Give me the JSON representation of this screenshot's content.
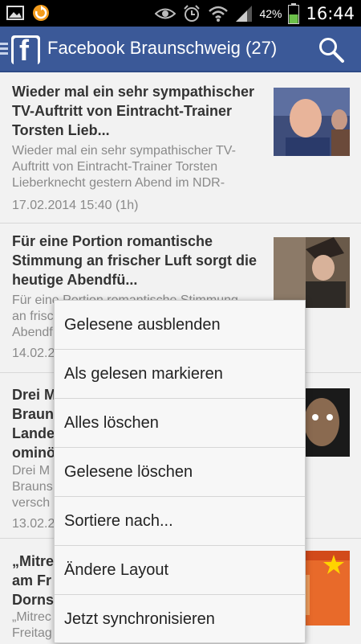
{
  "status_bar": {
    "battery_percent": "42%",
    "time": "16:44",
    "icons": [
      "image-icon",
      "notification-app-icon",
      "eye-icon",
      "alarm-icon",
      "wifi-icon",
      "signal-icon",
      "battery-icon"
    ]
  },
  "app_bar": {
    "title": "Facebook Braunschweig (27)",
    "brand_color": "#3b5998",
    "logo_letter": "f",
    "icons": [
      "menu-icon",
      "facebook-logo-icon",
      "search-icon"
    ]
  },
  "feed": {
    "items": [
      {
        "title": "Wieder mal ein sehr sympathischer TV-Auftritt von Eintracht-Trainer Torsten Lieb...",
        "description": "Wieder mal ein sehr sympathischer TV-\nAuftritt von Eintracht-Trainer Torsten\nLieberknecht gestern Abend im NDR-",
        "date": "17.02.2014 15:40 (1h)"
      },
      {
        "title": "Für eine Portion romantische Stimmung an frischer Luft sorgt die heutige Abendfü...",
        "description": "Für eine Portion romantische Stimmung\nan frisc\nAbendf",
        "date": "14.02.2"
      },
      {
        "title": "Drei M\nBraun\nLande\nominö",
        "description": "Drei M\nBrauns\nversch",
        "date": "13.02.2"
      },
      {
        "title": "„Mitre\nam Fr\nDornst",
        "description": "„Mitrec\nFreitag",
        "date": ""
      }
    ]
  },
  "menu": {
    "items": [
      "Gelesene ausblenden",
      "Als gelesen markieren",
      "Alles löschen",
      "Gelesene löschen",
      "Sortiere nach...",
      "Ändere Layout",
      "Jetzt synchronisieren"
    ]
  }
}
